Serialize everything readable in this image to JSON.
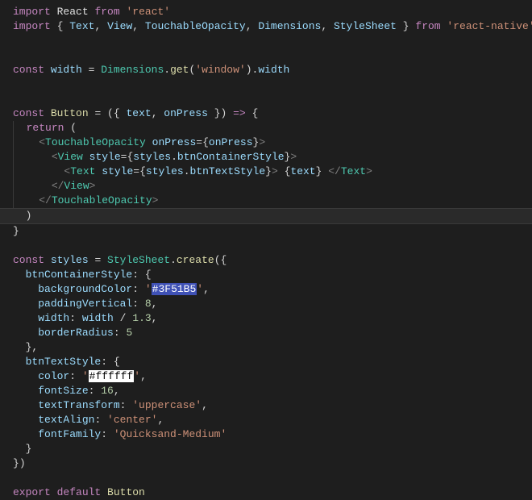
{
  "code": {
    "l1": {
      "kw_import": "import",
      "react": "React",
      "kw_from": "from",
      "str": "'react'"
    },
    "l2": {
      "kw_import": "import",
      "lb": "{ ",
      "Text": "Text",
      "View": "View",
      "TO": "TouchableOpacity",
      "Dim": "Dimensions",
      "SS": "StyleSheet",
      "rb": " }",
      "kw_from": "from",
      "str": "'react-native'"
    },
    "l4": {
      "kw": "const",
      "name": "width",
      "eq": " = ",
      "Dim": "Dimensions",
      "dot": ".",
      "get": "get",
      "lp": "(",
      "str": "'window'",
      "rp": ")",
      "dot2": ".",
      "width": "width"
    },
    "l6": {
      "kw": "const",
      "name": "Button",
      "eq": " = ",
      "lp": "(",
      "lb": "{ ",
      "text": "text",
      "c": ", ",
      "onPress": "onPress",
      "rb": " }",
      "rp": ")",
      "arrow": " => ",
      "ob": "{"
    },
    "l7": {
      "kw": "return",
      "lp": " ("
    },
    "l8": {
      "la": "<",
      "tag": "TouchableOpacity",
      "sp": " ",
      "attr": "onPress",
      "eq": "=",
      "lb": "{",
      "val": "onPress",
      "rb": "}",
      "ra": ">"
    },
    "l9": {
      "la": "<",
      "tag": "View",
      "sp": " ",
      "attr": "style",
      "eq": "=",
      "lb": "{",
      "styles": "styles",
      "dot": ".",
      "prop": "btnContainerStyle",
      "rb": "}",
      "ra": ">"
    },
    "l10": {
      "la": "<",
      "tag": "Text",
      "sp": " ",
      "attr": "style",
      "eq": "=",
      "lb": "{",
      "styles": "styles",
      "dot": ".",
      "prop": "btnTextStyle",
      "rb": "}",
      "ra": ">",
      "sp2": " ",
      "lb2": "{",
      "text": "text",
      "rb2": "}",
      "sp3": " ",
      "lc": "</",
      "tag2": "Text",
      "rc": ">"
    },
    "l11": {
      "lc": "</",
      "tag": "View",
      "rc": ">"
    },
    "l12": {
      "lc": "</",
      "tag": "TouchableOpacity",
      "rc": ">"
    },
    "l13": {
      "rp": ")"
    },
    "l14": {
      "rb": "}"
    },
    "l16": {
      "kw": "const",
      "name": "styles",
      "eq": " = ",
      "SS": "StyleSheet",
      "dot": ".",
      "create": "create",
      "lp": "(",
      "lb": "{"
    },
    "l17": {
      "prop": "btnContainerStyle",
      "colon": ": ",
      "lb": "{"
    },
    "l18": {
      "prop": "backgroundColor",
      "colon": ": ",
      "q1": "'",
      "val": "#3F51B5",
      "q2": "'",
      "c": ","
    },
    "l19": {
      "prop": "paddingVertical",
      "colon": ": ",
      "val": "8",
      "c": ","
    },
    "l20": {
      "prop": "width",
      "colon": ": ",
      "var": "width",
      "op": " / ",
      "val": "1.3",
      "c": ","
    },
    "l21": {
      "prop": "borderRadius",
      "colon": ": ",
      "val": "5"
    },
    "l22": {
      "rb": "}",
      "c": ","
    },
    "l23": {
      "prop": "btnTextStyle",
      "colon": ": ",
      "lb": "{"
    },
    "l24": {
      "prop": "color",
      "colon": ": ",
      "q1": "'",
      "val": "#ffffff",
      "q2": "'",
      "c": ","
    },
    "l25": {
      "prop": "fontSize",
      "colon": ": ",
      "val": "16",
      "c": ","
    },
    "l26": {
      "prop": "textTransform",
      "colon": ": ",
      "val": "'uppercase'",
      "c": ","
    },
    "l27": {
      "prop": "textAlign",
      "colon": ": ",
      "val": "'center'",
      "c": ","
    },
    "l28": {
      "prop": "fontFamily",
      "colon": ": ",
      "val": "'Quicksand-Medium'"
    },
    "l29": {
      "rb": "}"
    },
    "l30": {
      "rb": "}",
      "rp": ")"
    },
    "l32": {
      "kw1": "export",
      "kw2": "default",
      "name": "Button"
    }
  }
}
